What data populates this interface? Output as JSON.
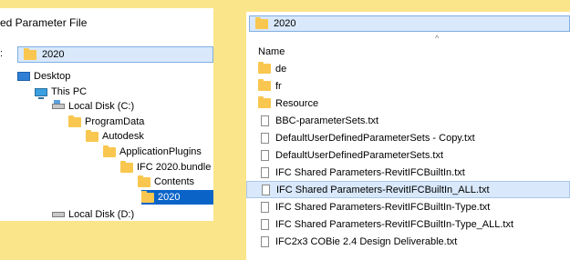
{
  "left": {
    "dialog_title": "ed Parameter File",
    "folder_value": "2020",
    "tick_mark": ":",
    "tree": [
      {
        "label": "Desktop",
        "icon": "desktop-icon"
      },
      {
        "label": "This PC",
        "icon": "pc-icon"
      },
      {
        "label": "Local Disk (C:)",
        "icon": "disk-icon"
      },
      {
        "label": "ProgramData",
        "icon": "folder-icon"
      },
      {
        "label": "Autodesk",
        "icon": "folder-icon"
      },
      {
        "label": "ApplicationPlugins",
        "icon": "folder-icon"
      },
      {
        "label": "IFC 2020.bundle",
        "icon": "folder-icon"
      },
      {
        "label": "Contents",
        "icon": "folder-icon"
      },
      {
        "label": "2020",
        "icon": "folder-icon",
        "selected": true
      },
      {
        "label": "Local Disk (D:)",
        "icon": "disk-icon"
      }
    ]
  },
  "right": {
    "folder_value": "2020",
    "column_header": "Name",
    "sort_indicator": "^",
    "files": [
      {
        "name": "de",
        "type": "folder"
      },
      {
        "name": "fr",
        "type": "folder"
      },
      {
        "name": "Resource",
        "type": "folder"
      },
      {
        "name": "BBC-parameterSets.txt",
        "type": "file"
      },
      {
        "name": "DefaultUserDefinedParameterSets - Copy.txt",
        "type": "file"
      },
      {
        "name": "DefaultUserDefinedParameterSets.txt",
        "type": "file"
      },
      {
        "name": "IFC Shared Parameters-RevitIFCBuiltIn.txt",
        "type": "file"
      },
      {
        "name": "IFC Shared Parameters-RevitIFCBuiltIn_ALL.txt",
        "type": "file",
        "selected": true
      },
      {
        "name": "IFC Shared Parameters-RevitIFCBuiltIn-Type.txt",
        "type": "file"
      },
      {
        "name": "IFC Shared Parameters-RevitIFCBuiltIn-Type_ALL.txt",
        "type": "file"
      },
      {
        "name": "IFC2x3 COBie 2.4 Design Deliverable.txt",
        "type": "file"
      }
    ]
  }
}
